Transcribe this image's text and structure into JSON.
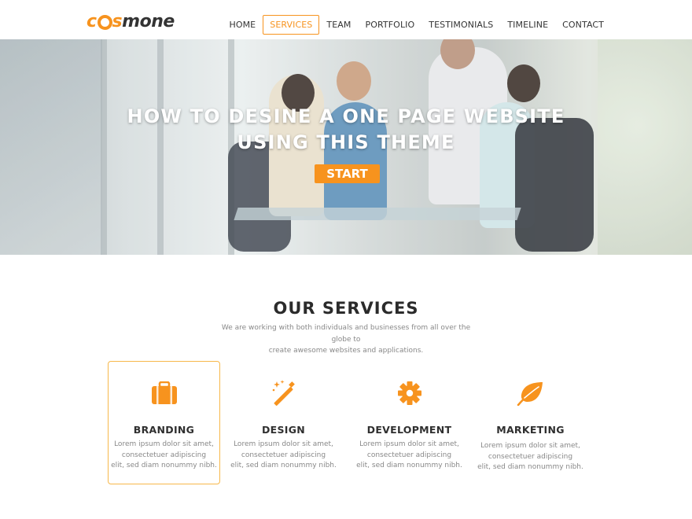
{
  "brand": {
    "logo_prefix": "c",
    "logo_middle": "s",
    "logo_suffix": "mone",
    "accent_color": "#f7931e"
  },
  "nav": {
    "items": [
      {
        "label": "HOME",
        "active": false
      },
      {
        "label": "SERVICES",
        "active": true
      },
      {
        "label": "TEAM",
        "active": false
      },
      {
        "label": "PORTFOLIO",
        "active": false
      },
      {
        "label": "TESTIMONIALS",
        "active": false
      },
      {
        "label": "TIMELINE",
        "active": false
      },
      {
        "label": "CONTACT",
        "active": false
      }
    ]
  },
  "hero": {
    "title_line1": "HOW TO DESINE A ONE PAGE WEBSITE",
    "title_line2": "USING THIS THEME",
    "button_label": "START"
  },
  "services": {
    "title": "OUR SERVICES",
    "subtitle_line1": "We are working with both individuals and businesses from all over the globe to",
    "subtitle_line2": "create awesome websites and applications.",
    "cards": [
      {
        "icon": "briefcase-icon",
        "title": "BRANDING",
        "desc1": "Lorem ipsum dolor sit amet,",
        "desc2": "consectetuer adipiscing",
        "desc3": "elit, sed diam nonummy nibh.",
        "active": true
      },
      {
        "icon": "magic-wand-icon",
        "title": "DESIGN",
        "desc1": "Lorem ipsum dolor sit amet,",
        "desc2": "consectetuer adipiscing",
        "desc3": "elit, sed diam nonummy nibh.",
        "active": false
      },
      {
        "icon": "gear-icon",
        "title": "DEVELOPMENT",
        "desc1": "Lorem ipsum dolor sit amet,",
        "desc2": "consectetuer adipiscing",
        "desc3": "elit, sed diam nonummy nibh.",
        "active": false
      },
      {
        "icon": "leaf-icon",
        "title": "MARKETING",
        "desc1": "Lorem ipsum dolor sit amet,",
        "desc2": "consectetuer adipiscing",
        "desc3": "elit, sed diam nonummy nibh.",
        "active": false
      }
    ]
  }
}
